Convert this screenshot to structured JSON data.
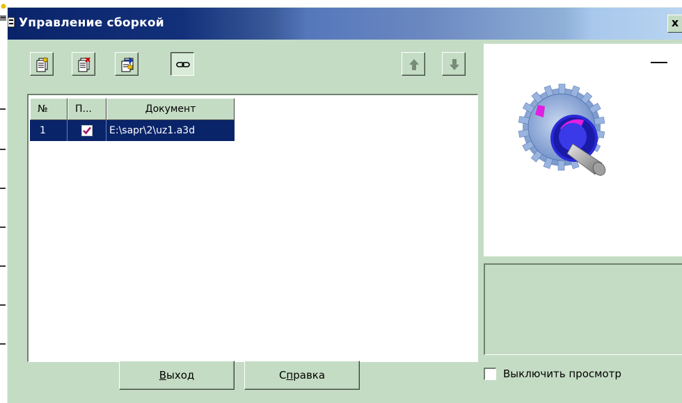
{
  "window": {
    "title": "Управление сборкой",
    "close_label": "x"
  },
  "toolbar": {
    "buttons": [
      {
        "icon": "add-document-icon"
      },
      {
        "icon": "remove-document-icon"
      },
      {
        "icon": "replace-document-icon"
      },
      {
        "icon": "link-icon",
        "pressed": true
      },
      {
        "icon": "arrow-up-icon",
        "disabled": true
      },
      {
        "icon": "arrow-down-icon",
        "disabled": true
      }
    ]
  },
  "table": {
    "columns": [
      "№",
      "П...",
      "Документ"
    ],
    "rows": [
      {
        "num": "1",
        "checked": true,
        "document": "E:\\sapr\\2\\uz1.a3d",
        "selected": true
      }
    ]
  },
  "preview": {
    "minimize_label": "—",
    "image": "gear-shaft-3d-model"
  },
  "buttons": {
    "exit_accel": "В",
    "exit_rest": "ыход",
    "help_pre": "С",
    "help_accel": "п",
    "help_rest": "равка"
  },
  "disable_preview": {
    "label": "Выключить просмотр",
    "checked": false
  },
  "colors": {
    "dialog_bg": "#c4dcc4",
    "title_start": "#0a246a",
    "selection": "#0a246a"
  }
}
